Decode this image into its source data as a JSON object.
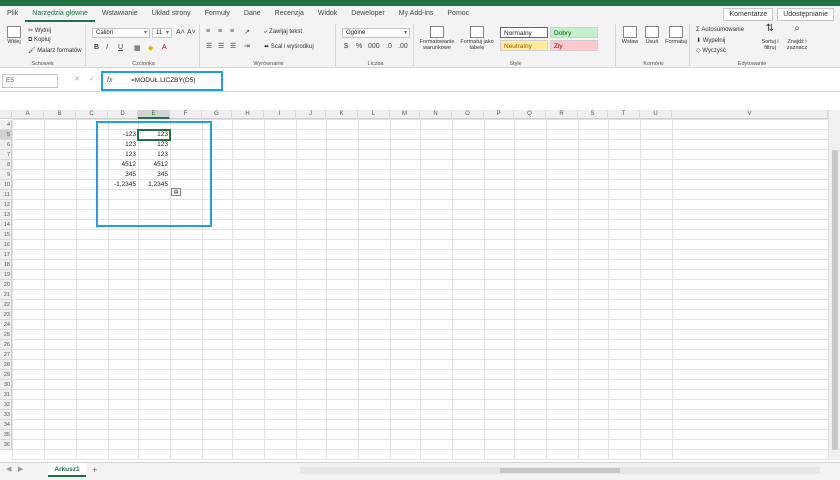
{
  "ribbon_tabs": [
    "Plik",
    "Narzędzia główne",
    "Wstawianie",
    "Układ strony",
    "Formuły",
    "Dane",
    "Recenzja",
    "Widok",
    "Deweloper",
    "My Add-ins",
    "Pomoc"
  ],
  "active_tab_index": 1,
  "header_buttons": {
    "comments": "Komentarze",
    "share": "Udostępnianie"
  },
  "clipboard": {
    "label": "Schowek",
    "paste": "Wklej",
    "cut": "Wytnij",
    "copy": "Kopiuj",
    "format_painter": "Malarz formatów"
  },
  "font": {
    "label": "Czcionka",
    "name": "Calibri",
    "size": "11",
    "bold": "B",
    "italic": "I",
    "underline": "U"
  },
  "alignment": {
    "label": "Wyrównanie",
    "wrap": "Zawijaj tekst",
    "merge": "Scal i wyśrodkuj"
  },
  "number": {
    "label": "Liczba",
    "format": "Ogólne"
  },
  "styles": {
    "label": "Style",
    "conditional": "Formatowanie warunkowe",
    "as_table": "Formatuj jako tabelę",
    "normal": "Normalny",
    "good": "Dobry",
    "neutral": "Neutralny",
    "bad": "Zły"
  },
  "cells_group": {
    "label": "Komórki",
    "insert": "Wstaw",
    "delete": "Usuń",
    "format": "Formatuj"
  },
  "editing": {
    "label": "Edytowanie",
    "autosum": "Autosumowanie",
    "fill": "Wypełnij",
    "clear": "Wyczyść",
    "sort": "Sortuj i filtruj",
    "find": "Znajdź i zaznacz"
  },
  "formula_bar": {
    "name_box": "E5",
    "fx": "fx",
    "formula": "=MODUŁ.LICZBY(D5)"
  },
  "columns": [
    "A",
    "B",
    "C",
    "D",
    "E",
    "F",
    "G",
    "H",
    "I",
    "J",
    "K",
    "L",
    "M",
    "N",
    "O",
    "P",
    "Q",
    "R",
    "S",
    "T",
    "U",
    "V"
  ],
  "rows": [
    "4",
    "5",
    "6",
    "7",
    "8",
    "9",
    "10",
    "11",
    "12",
    "13",
    "14",
    "15",
    "16",
    "17",
    "18",
    "19",
    "20",
    "21",
    "22",
    "23",
    "24",
    "25",
    "26",
    "27",
    "28",
    "29",
    "30",
    "31",
    "32",
    "33",
    "34",
    "35",
    "36"
  ],
  "cells": {
    "D": [
      "-123",
      "123",
      "123",
      "4512",
      "345",
      "-1,2345"
    ],
    "E": [
      "123",
      "123",
      "123",
      "4512",
      "345",
      "1,2345"
    ]
  },
  "sheet": {
    "name": "Arkusz1",
    "add": "+"
  },
  "colors": {
    "accent": "#217346",
    "highlight": "#1da1e0"
  }
}
